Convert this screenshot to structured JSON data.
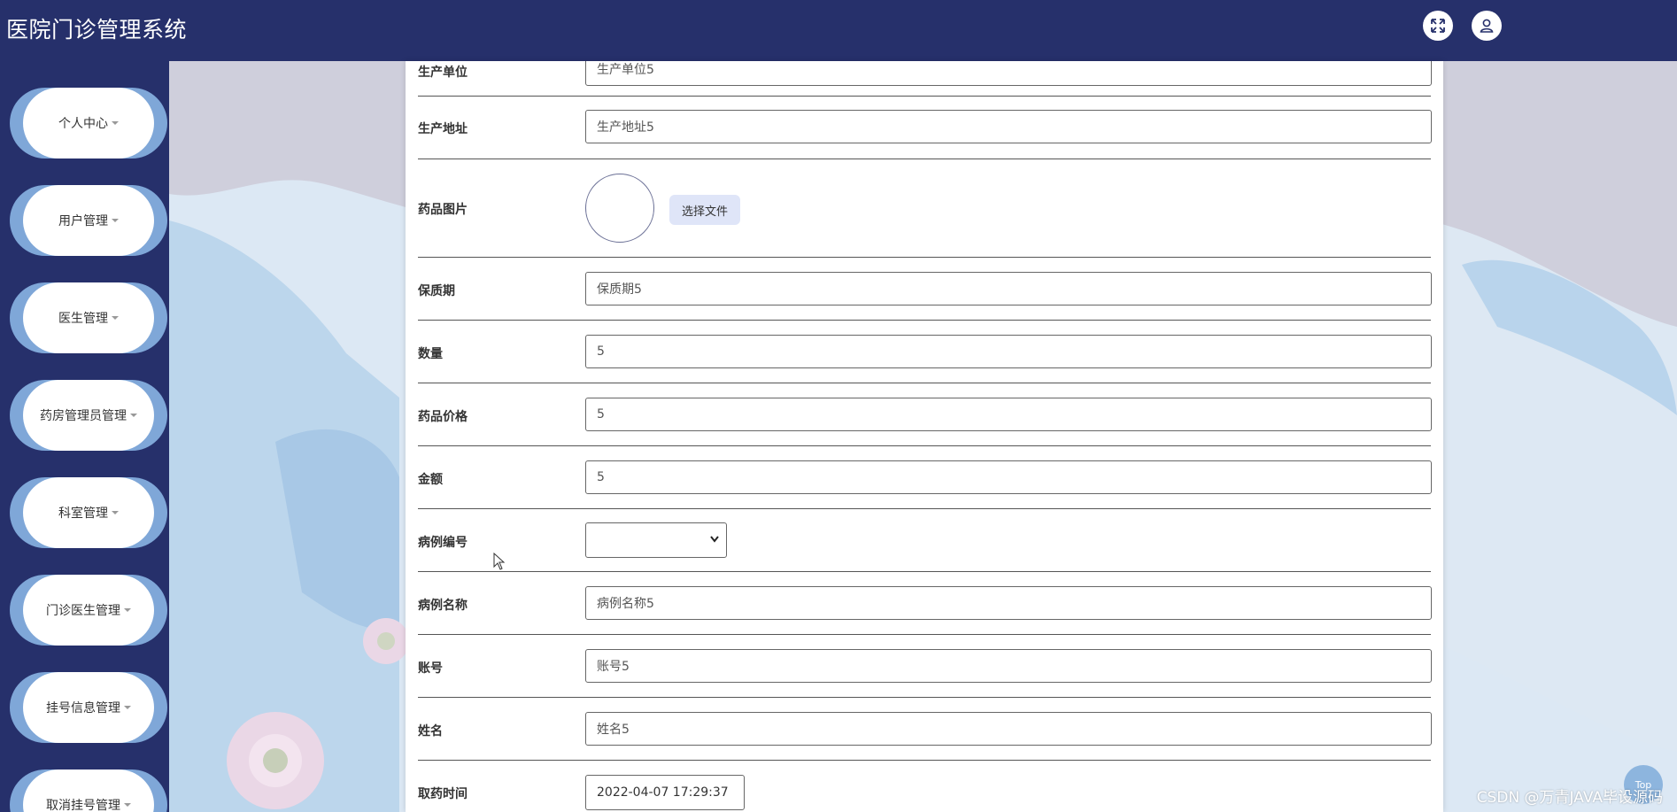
{
  "header": {
    "app_title": "医院门诊管理系统",
    "icons": [
      "fullscreen-icon",
      "user-icon"
    ]
  },
  "sidebar": {
    "items": [
      {
        "label": "个人中心"
      },
      {
        "label": "用户管理"
      },
      {
        "label": "医生管理"
      },
      {
        "label": "药房管理员管理"
      },
      {
        "label": "科室管理"
      },
      {
        "label": "门诊医生管理"
      },
      {
        "label": "挂号信息管理"
      },
      {
        "label": "取消挂号管理"
      }
    ]
  },
  "form": {
    "manufacturer": {
      "label": "生产单位",
      "value": "生产单位5"
    },
    "address": {
      "label": "生产地址",
      "value": "生产地址5"
    },
    "image": {
      "label": "药品图片",
      "button": "选择文件"
    },
    "shelf_life": {
      "label": "保质期",
      "value": "保质期5"
    },
    "quantity": {
      "label": "数量",
      "value": "5"
    },
    "price": {
      "label": "药品价格",
      "value": "5"
    },
    "amount": {
      "label": "金额",
      "value": "5"
    },
    "case_no": {
      "label": "病例编号",
      "value": ""
    },
    "case_name": {
      "label": "病例名称",
      "value": "病例名称5"
    },
    "account": {
      "label": "账号",
      "value": "账号5"
    },
    "name": {
      "label": "姓名",
      "value": "姓名5"
    },
    "pickup_time": {
      "label": "取药时间",
      "value": "2022-04-07 17:29:37"
    }
  },
  "footer": {
    "watermark": "CSDN @万青JAVA毕设源码",
    "to_top_label": "Top"
  },
  "colors": {
    "header_bg": "#26306b",
    "sidebar_bg": "#26306b",
    "menu_accent": "#7fa7d8",
    "upload_btn_bg": "#dfe5f8"
  }
}
